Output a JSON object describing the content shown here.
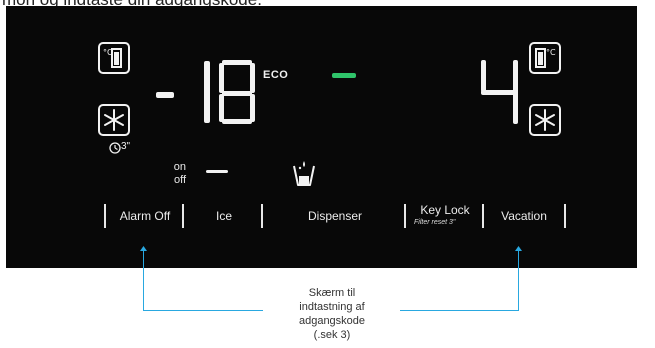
{
  "header": {
    "text": "mon og indtaste din adgangskode."
  },
  "display": {
    "freezer_temp": "- 18",
    "eco_label": "ECO",
    "fridge_temp": "4",
    "timer_label": "3\"",
    "on_label": "on",
    "off_label": "off"
  },
  "buttons": {
    "alarm_off": "Alarm Off",
    "ice": "Ice",
    "dispenser": "Dispenser",
    "key_lock": "Key Lock",
    "key_lock_sub": "Filter reset 3\"",
    "vacation": "Vacation"
  },
  "callout": {
    "lines": [
      "Skærm til",
      "indtastning af",
      "adgangskode",
      "(.sek 3)"
    ]
  },
  "colors": {
    "panel": "#080808",
    "eco_indicator": "#2fc46a",
    "callout_line": "#29a8e0"
  }
}
